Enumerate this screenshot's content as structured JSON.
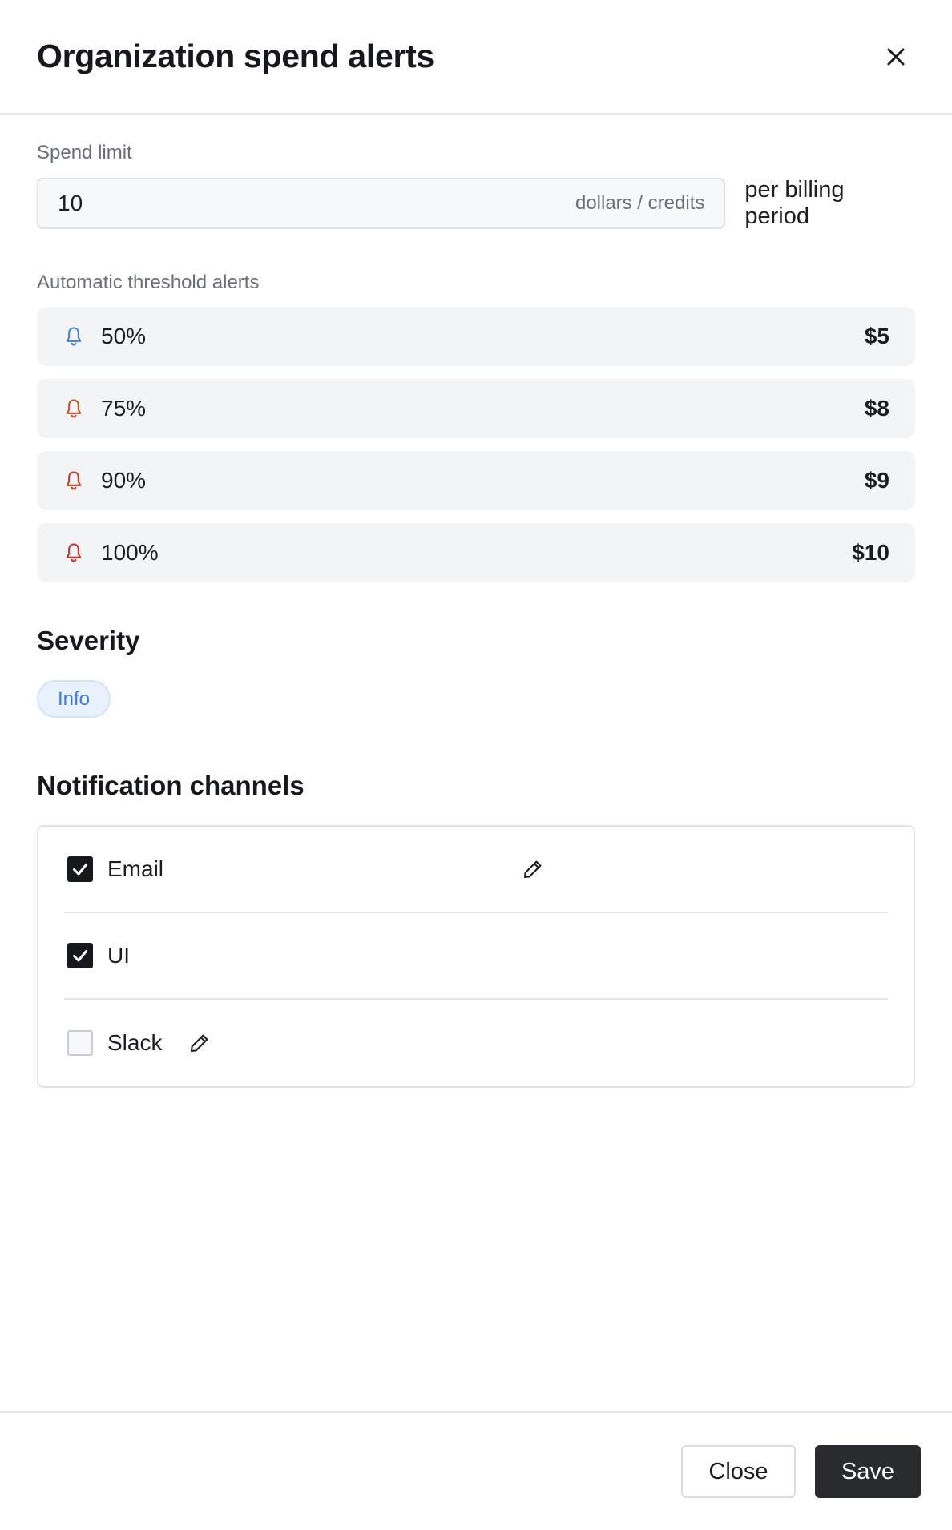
{
  "header": {
    "title": "Organization spend alerts"
  },
  "spend_limit": {
    "label": "Spend limit",
    "value": "10",
    "unit": "dollars / credits",
    "suffix": "per billing period"
  },
  "threshold_alerts": {
    "label": "Automatic threshold alerts",
    "items": [
      {
        "percent": "50%",
        "amount": "$5",
        "bell_color": "#4a7fd6"
      },
      {
        "percent": "75%",
        "amount": "$8",
        "bell_color": "#c0532a"
      },
      {
        "percent": "90%",
        "amount": "$9",
        "bell_color": "#b8401f"
      },
      {
        "percent": "100%",
        "amount": "$10",
        "bell_color": "#d0302c"
      }
    ]
  },
  "severity": {
    "title": "Severity",
    "value": "Info"
  },
  "notification_channels": {
    "title": "Notification channels",
    "items": [
      {
        "label": "Email",
        "checked": true,
        "editable": true
      },
      {
        "label": "UI",
        "checked": true,
        "editable": false
      },
      {
        "label": "Slack",
        "checked": false,
        "editable": true
      }
    ]
  },
  "footer": {
    "close_label": "Close",
    "save_label": "Save"
  },
  "colors": {
    "primary_button": "#2a2b2f",
    "badge_bg": "#e9f1fd",
    "badge_text": "#3f7ad8"
  }
}
